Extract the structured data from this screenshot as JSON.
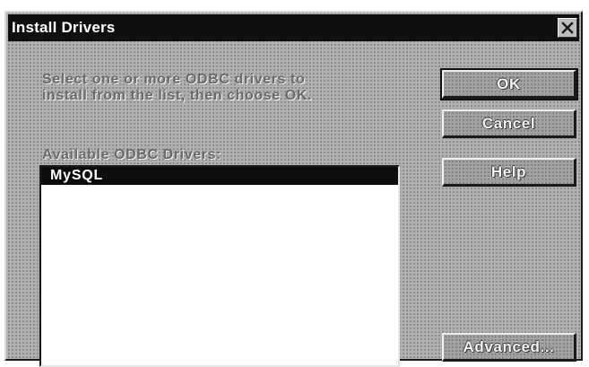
{
  "dialog": {
    "title": "Install Drivers",
    "prompt_line1": "Select one or more ODBC drivers to",
    "prompt_line2": "install from the list, then choose OK.",
    "list_label": "Available ODBC Drivers:",
    "drivers": [
      {
        "label": "MySQL",
        "selected": true
      }
    ],
    "buttons": {
      "ok": "OK",
      "cancel": "Cancel",
      "help": "Help",
      "advanced": "Advanced..."
    }
  },
  "icons": {
    "close": "close-icon"
  },
  "colors": {
    "titlebar": "#0f0f0f",
    "dialog_face": "#a9a9a9",
    "selection": "#0d0d0d",
    "list_background": "#ffffff"
  }
}
